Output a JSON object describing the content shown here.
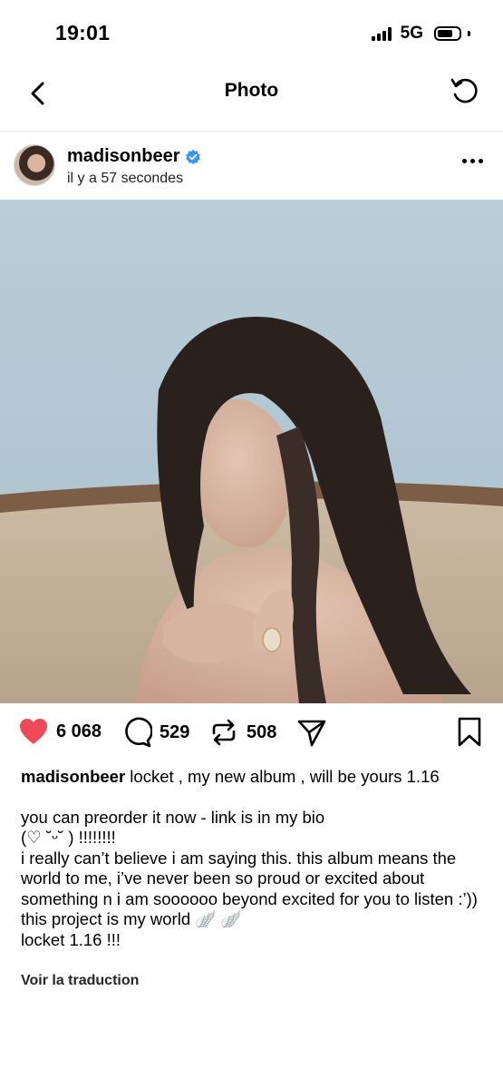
{
  "status": {
    "time": "19:01",
    "network": "5G"
  },
  "nav": {
    "title": "Photo"
  },
  "post": {
    "username": "madisonbeer",
    "time_ago": "il y a 57 secondes",
    "likes": "6 068",
    "comments": "529",
    "reposts": "508"
  },
  "caption": {
    "username": "madisonbeer",
    "line1": "locket , my new album , will be yours 1.16",
    "line2": "you can preorder it now - link is in my bio",
    "line3": "(♡ ˘ᵕ˘ ) !!!!!!!!",
    "line4": "i really can’t believe i am saying this. this album means the world to me, i’ve never been so proud or excited about something n i am soooooo beyond excited for you to listen :’)) this project is my world 🪽 🪽",
    "line5": "locket 1.16 !!!"
  },
  "translate_label": "Voir la traduction",
  "colors": {
    "like": "#ed4956",
    "verified": "#3897f0"
  }
}
